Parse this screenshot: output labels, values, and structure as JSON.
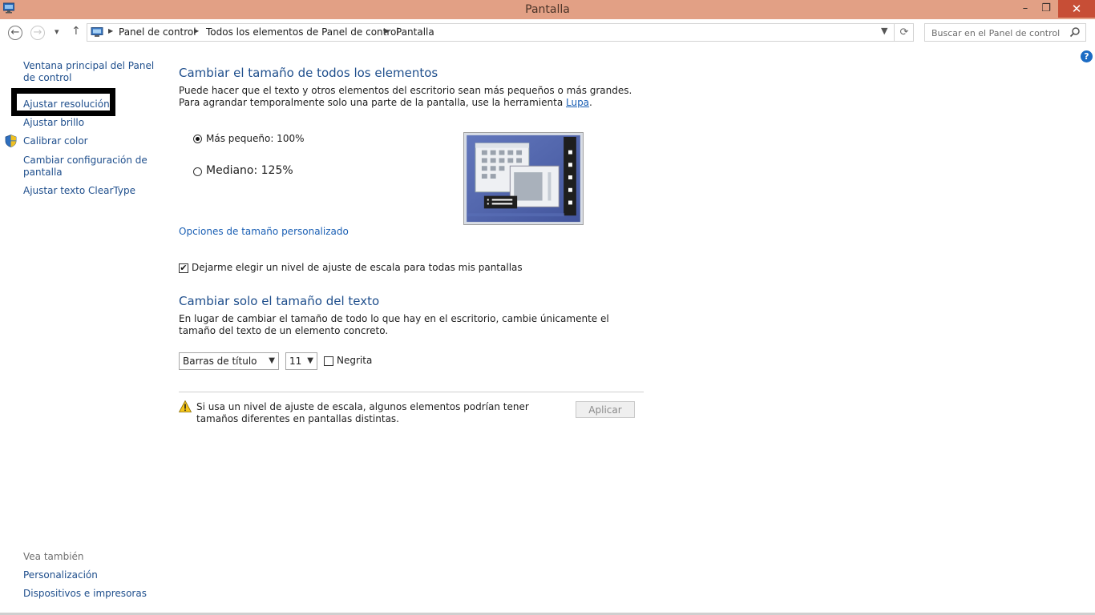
{
  "window": {
    "title": "Pantalla",
    "controls": {
      "minimize": "–",
      "maximize": "❐",
      "close": "✕"
    },
    "accent": "#e2a085",
    "close_color": "#c74e36"
  },
  "navigation": {
    "back_icon": "←",
    "forward_icon": "→",
    "recent_icon": "▾",
    "up_icon": "↑",
    "breadcrumb": [
      "Panel de control",
      "Todos los elementos de Panel de control",
      "Pantalla"
    ],
    "search_placeholder": "Buscar en el Panel de control",
    "help_icon": "?"
  },
  "sidebar": {
    "items": [
      "Ventana principal del Panel de control",
      "Ajustar resolución",
      "Ajustar brillo",
      "Calibrar color",
      "Cambiar configuración de pantalla",
      "Ajustar texto ClearType"
    ],
    "see_also_label": "Vea también",
    "see_also": [
      "Personalización",
      "Dispositivos e impresoras"
    ]
  },
  "main": {
    "section1_title": "Cambiar el tamaño de todos los elementos",
    "section1_desc_part1": "Puede hacer que el texto y otros elementos del escritorio sean más pequeños o más grandes. Para agrandar temporalmente solo una parte de la pantalla, use la herramienta ",
    "section1_desc_link": "Lupa",
    "section1_desc_end": ".",
    "options": [
      {
        "label": "Más pequeño: 100%",
        "selected": true
      },
      {
        "label": "Mediano: 125%",
        "selected": false
      }
    ],
    "custom_size_link": "Opciones de tamaño personalizado",
    "scaling_checkbox_label": "Dejarme elegir un nivel de ajuste de escala para todas mis pantallas",
    "scaling_checkbox_checked": true,
    "section2_title": "Cambiar solo el tamaño del texto",
    "section2_desc": "En lugar de cambiar el tamaño de todo lo que hay en el escritorio, cambie únicamente el tamaño del texto de un elemento concreto.",
    "element_select_value": "Barras de título",
    "size_select_value": "11",
    "bold_label": "Negrita",
    "bold_checked": false,
    "warning_text": "Si usa un nivel de ajuste de escala, algunos elementos podrían tener tamaños diferentes en pantallas distintas.",
    "apply_label": "Aplicar"
  },
  "colors": {
    "link": "#1e4e8c",
    "heading": "#1e4e8c"
  }
}
